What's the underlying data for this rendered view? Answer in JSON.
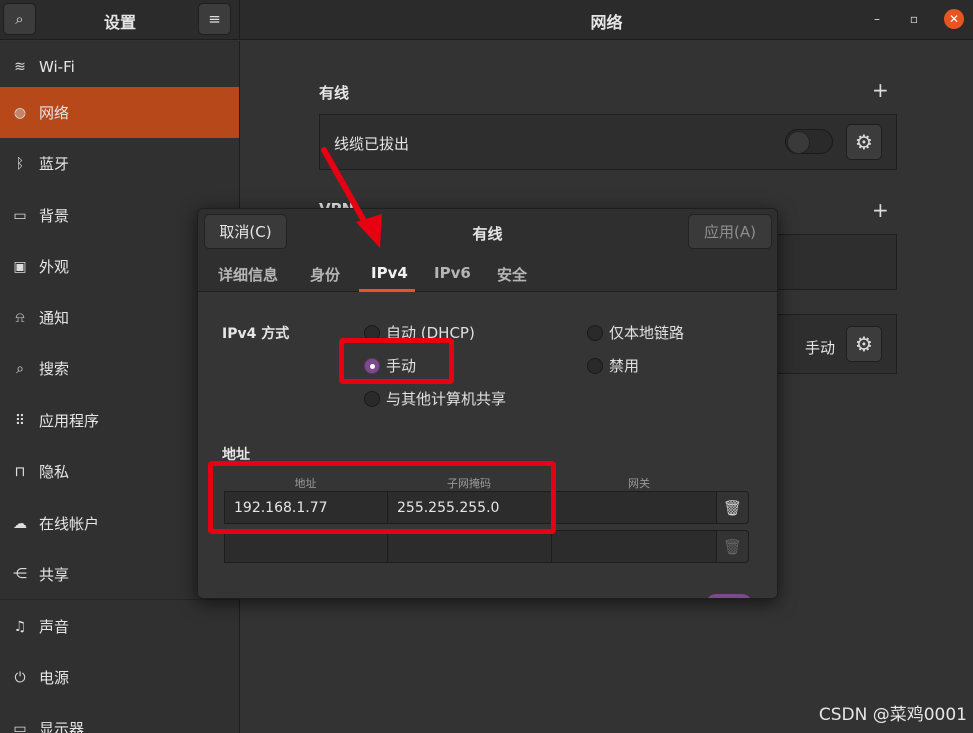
{
  "sidebar": {
    "title": "设置",
    "items": [
      {
        "label": "Wi-Fi",
        "icon": "wifi-icon",
        "glyph": "≋"
      },
      {
        "label": "网络",
        "icon": "network-icon",
        "glyph": "◍"
      },
      {
        "label": "蓝牙",
        "icon": "bluetooth-icon",
        "glyph": "ᛒ"
      },
      {
        "label": "背景",
        "icon": "background-icon",
        "glyph": "▭"
      },
      {
        "label": "外观",
        "icon": "appearance-icon",
        "glyph": "▣"
      },
      {
        "label": "通知",
        "icon": "bell-icon",
        "glyph": "⍾"
      },
      {
        "label": "搜索",
        "icon": "search-icon",
        "glyph": "⌕"
      },
      {
        "label": "应用程序",
        "icon": "apps-grid-icon",
        "glyph": "⠿"
      },
      {
        "label": "隐私",
        "icon": "lock-icon",
        "glyph": "⊓"
      },
      {
        "label": "在线帐户",
        "icon": "cloud-icon",
        "glyph": "☁"
      },
      {
        "label": "共享",
        "icon": "share-icon",
        "glyph": "⋲"
      },
      {
        "label": "声音",
        "icon": "music-note-icon",
        "glyph": "♫"
      },
      {
        "label": "电源",
        "icon": "power-icon",
        "glyph": "⏻"
      },
      {
        "label": "显示器",
        "icon": "display-icon",
        "glyph": "▭"
      }
    ]
  },
  "header": {
    "title": "网络",
    "search_glyph": "⌕",
    "menu_glyph": "≡",
    "minimize_glyph": "–",
    "maximize_glyph": "▫",
    "close_glyph": "✕"
  },
  "main": {
    "wired_section": "有线",
    "wired_status": "线缆已拔出",
    "vpn_section_partial": "VPN",
    "proxy_value": "手动",
    "plus_glyph": "+",
    "gear_glyph": "⚙"
  },
  "dialog": {
    "cancel_label": "取消(C)",
    "title": "有线",
    "apply_label": "应用(A)",
    "tabs": [
      "详细信息",
      "身份",
      "IPv4",
      "IPv6",
      "安全"
    ],
    "active_tab": "IPv4",
    "ipv4_method_label": "IPv4 方式",
    "methods": {
      "auto_dhcp": "自动 (DHCP)",
      "manual": "手动",
      "shared": "与其他计算机共享",
      "link_local": "仅本地链路",
      "disabled": "禁用"
    },
    "selected_method": "手动",
    "address_section": "地址",
    "columns": {
      "address": "地址",
      "netmask": "子网掩码",
      "gateway": "网关"
    },
    "rows": [
      {
        "address": "192.168.1.77",
        "netmask": "255.255.255.0",
        "gateway": ""
      },
      {
        "address": "",
        "netmask": "",
        "gateway": ""
      }
    ],
    "trash_glyph": "🗑"
  },
  "annotations": {
    "highlight_color": "#e60012",
    "accent_color": "#e95420",
    "radio_checked_color": "#7b4a8a"
  },
  "watermark": "CSDN @菜鸡0001"
}
